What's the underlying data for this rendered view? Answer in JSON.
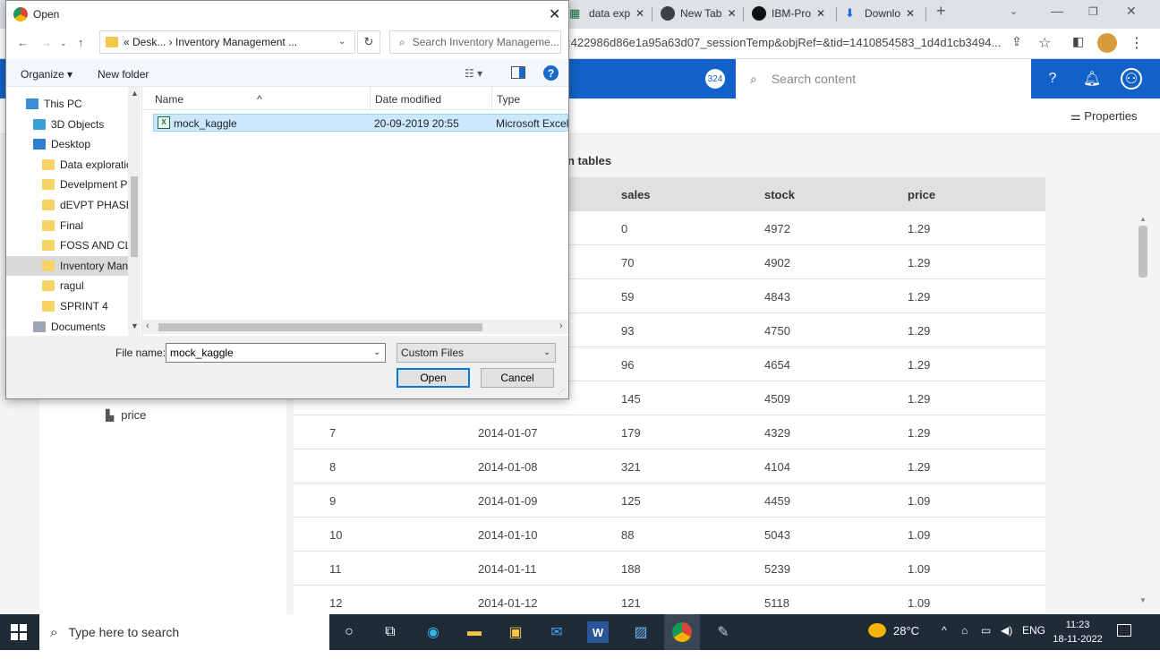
{
  "browser": {
    "tabs": [
      {
        "label": "data exp",
        "icon": "excel-icon"
      },
      {
        "label": "New Tab",
        "icon": "chrome-icon"
      },
      {
        "label": "IBM-Pro",
        "icon": "github-icon"
      },
      {
        "label": "Downlo",
        "icon": "download-icon"
      }
    ],
    "url_fragment": ":422986d86e1a95a63d07_sessionTemp&objRef=&tid=1410854583_1d4d1cb3494...",
    "colors": {
      "tabstrip": "#dee1e6",
      "app_header": "#1261c8"
    }
  },
  "app": {
    "badge_count": "324",
    "search_placeholder": "Search content",
    "properties_label": "Properties",
    "table_heading": "n tables",
    "tree_item": "price",
    "table": {
      "columns": [
        "sales",
        "stock",
        "price"
      ],
      "rows": [
        {
          "id": "",
          "date": "",
          "sales": "0",
          "stock": "4972",
          "price": "1.29"
        },
        {
          "id": "",
          "date": "",
          "sales": "70",
          "stock": "4902",
          "price": "1.29"
        },
        {
          "id": "",
          "date": "",
          "sales": "59",
          "stock": "4843",
          "price": "1.29"
        },
        {
          "id": "",
          "date": "",
          "sales": "93",
          "stock": "4750",
          "price": "1.29"
        },
        {
          "id": "",
          "date": "",
          "sales": "96",
          "stock": "4654",
          "price": "1.29"
        },
        {
          "id": "",
          "date": "",
          "sales": "145",
          "stock": "4509",
          "price": "1.29"
        },
        {
          "id": "7",
          "date": "2014-01-07",
          "sales": "179",
          "stock": "4329",
          "price": "1.29"
        },
        {
          "id": "8",
          "date": "2014-01-08",
          "sales": "321",
          "stock": "4104",
          "price": "1.29"
        },
        {
          "id": "9",
          "date": "2014-01-09",
          "sales": "125",
          "stock": "4459",
          "price": "1.09"
        },
        {
          "id": "10",
          "date": "2014-01-10",
          "sales": "88",
          "stock": "5043",
          "price": "1.09"
        },
        {
          "id": "11",
          "date": "2014-01-11",
          "sales": "188",
          "stock": "5239",
          "price": "1.09"
        },
        {
          "id": "12",
          "date": "2014-01-12",
          "sales": "121",
          "stock": "5118",
          "price": "1.09"
        }
      ]
    }
  },
  "dialog": {
    "title": "Open",
    "breadcrumb": "« Desk... › Inventory Management ...",
    "search_placeholder": "Search Inventory Manageme...",
    "organize_label": "Organize ▾",
    "new_folder_label": "New folder",
    "nav_items": [
      {
        "label": "This PC",
        "kind": "pc"
      },
      {
        "label": "3D Objects",
        "kind": "cube"
      },
      {
        "label": "Desktop",
        "kind": "desktop"
      },
      {
        "label": "Data exploratic",
        "kind": "folder"
      },
      {
        "label": "Develpment Ph",
        "kind": "folder"
      },
      {
        "label": "dEVPT PHASE r",
        "kind": "folder"
      },
      {
        "label": "Final",
        "kind": "folder"
      },
      {
        "label": "FOSS AND CLC",
        "kind": "folder"
      },
      {
        "label": "Inventory Man",
        "kind": "folder",
        "selected": true
      },
      {
        "label": "ragul",
        "kind": "folder"
      },
      {
        "label": "SPRINT 4",
        "kind": "folder"
      },
      {
        "label": "Documents",
        "kind": "docs"
      }
    ],
    "columns": {
      "name": "Name",
      "date": "Date modified",
      "type": "Type"
    },
    "file": {
      "name": "mock_kaggle",
      "date": "20-09-2019 20:55",
      "type": "Microsoft Excel"
    },
    "filename_label": "File name:",
    "filename_value": "mock_kaggle",
    "filter_value": "Custom Files",
    "open_label": "Open",
    "cancel_label": "Cancel"
  },
  "taskbar": {
    "search_placeholder": "Type here to search",
    "temperature": "28°C",
    "language": "ENG",
    "time": "11:23",
    "date": "18-11-2022"
  }
}
